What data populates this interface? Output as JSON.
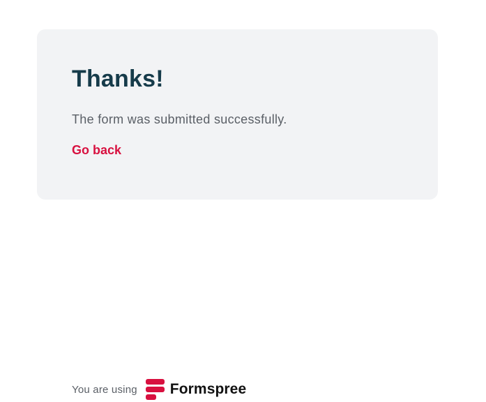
{
  "card": {
    "title": "Thanks!",
    "message": "The form was submitted successfully.",
    "back_link": "Go back"
  },
  "footer": {
    "prefix": "You are using",
    "brand_name": "Formspree",
    "brand_icon": "formspree-logo-icon"
  },
  "colors": {
    "card_background": "#f2f3f5",
    "title": "#163b4a",
    "accent": "#d8103f",
    "body_text": "#5a5f66"
  }
}
